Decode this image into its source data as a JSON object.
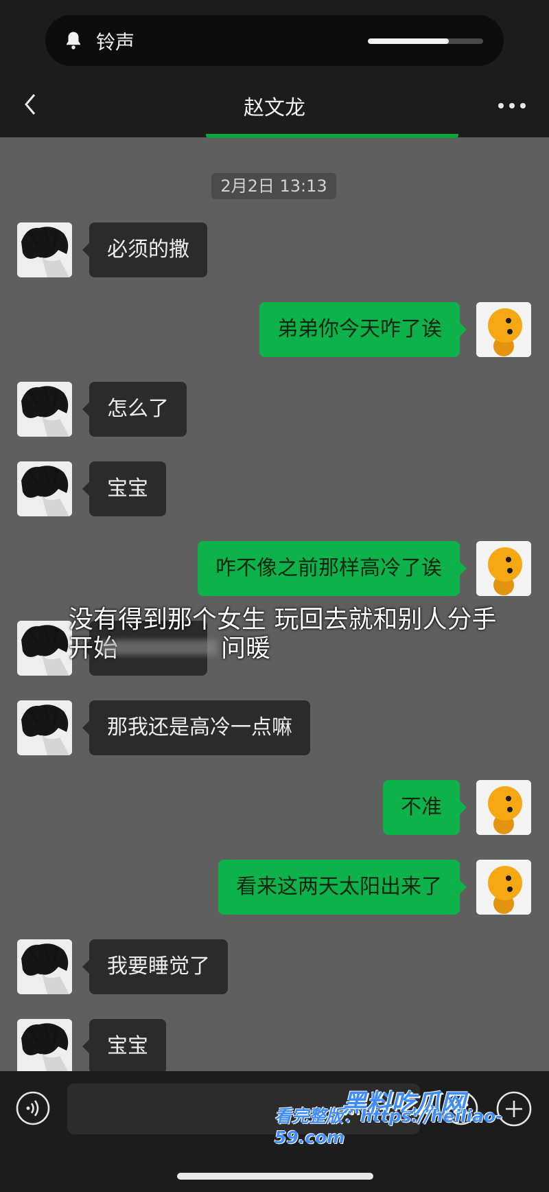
{
  "status": {
    "ringer_label": "铃声",
    "ringer_volume": 0.7
  },
  "header": {
    "title": "赵文龙"
  },
  "timestamp": "2月2日 13:13",
  "messages": [
    {
      "side": "left",
      "text": "必须的撒"
    },
    {
      "side": "right",
      "text": "弟弟你今天咋了诶"
    },
    {
      "side": "left",
      "text": "怎么了"
    },
    {
      "side": "left",
      "text": "宝宝"
    },
    {
      "side": "right",
      "text": "咋不像之前那样高冷了诶"
    },
    {
      "side": "left",
      "text": ""
    },
    {
      "side": "left",
      "text": "那我还是高冷一点嘛"
    },
    {
      "side": "right",
      "text": "不准"
    },
    {
      "side": "right",
      "text": "看来这两天太阳出来了"
    },
    {
      "side": "left",
      "text": "我要睡觉了"
    },
    {
      "side": "left",
      "text": "宝宝"
    }
  ],
  "overlay_caption": {
    "line1": "没有得到那个女生 玩回去就和别人分手",
    "line2": "开始",
    "line2_end": "问暖"
  },
  "watermark": {
    "brand": "黑料吃瓜网",
    "url_line": "看完整版：https://heiliao-59.com"
  },
  "colors": {
    "bubble_green": "#0eb24a",
    "bubble_dark": "#2b2b2b",
    "background": "#5f5f5f",
    "bar": "#1c1c1c"
  }
}
